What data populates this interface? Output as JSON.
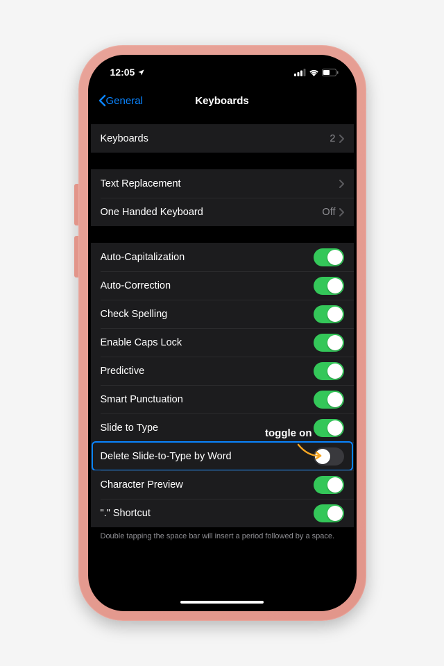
{
  "status": {
    "time": "12:05",
    "location_glyph": "➤"
  },
  "nav": {
    "back": "General",
    "title": "Keyboards"
  },
  "group1": {
    "keyboards": {
      "label": "Keyboards",
      "value": "2"
    }
  },
  "group2": {
    "text_replacement": {
      "label": "Text Replacement"
    },
    "one_handed": {
      "label": "One Handed Keyboard",
      "value": "Off"
    }
  },
  "group3": {
    "auto_cap": {
      "label": "Auto-Capitalization"
    },
    "auto_correct": {
      "label": "Auto-Correction"
    },
    "check_spell": {
      "label": "Check Spelling"
    },
    "caps_lock": {
      "label": "Enable Caps Lock"
    },
    "predictive": {
      "label": "Predictive"
    },
    "smart_punc": {
      "label": "Smart Punctuation"
    },
    "slide_type": {
      "label": "Slide to Type"
    },
    "delete_slide": {
      "label": "Delete Slide-to-Type by Word"
    },
    "char_preview": {
      "label": "Character Preview"
    },
    "dot_shortcut": {
      "label": "\".\" Shortcut"
    }
  },
  "footer": "Double tapping the space bar will insert a period followed by a space.",
  "annotation": {
    "text": "toggle on"
  }
}
